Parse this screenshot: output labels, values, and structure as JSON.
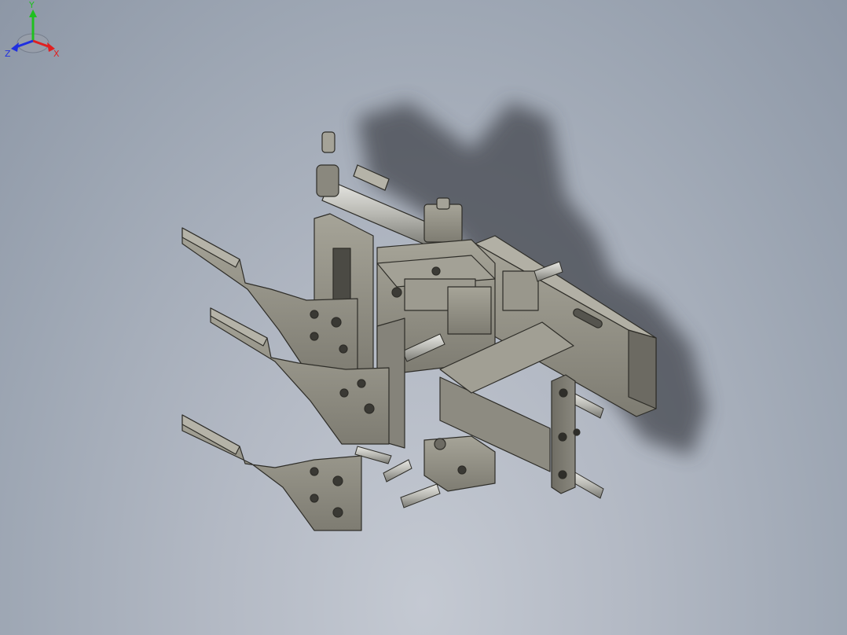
{
  "viewport": {
    "background_top": "#8d97a6",
    "background_bottom": "#c4c9d2",
    "model_color": "#8f8d82",
    "shadow_color": "#3c4047"
  },
  "triad": {
    "x_label": "X",
    "y_label": "Y",
    "z_label": "Z",
    "x_color": "#e02020",
    "y_color": "#20c020",
    "z_color": "#2030e0"
  }
}
